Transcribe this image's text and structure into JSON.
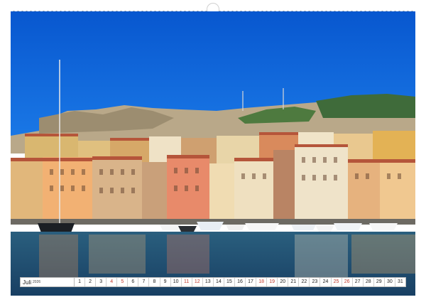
{
  "calendar": {
    "month": "Juli",
    "year": "2026",
    "days": [
      "1",
      "2",
      "3",
      "4",
      "5",
      "6",
      "7",
      "8",
      "9",
      "10",
      "11",
      "12",
      "13",
      "14",
      "15",
      "16",
      "17",
      "18",
      "19",
      "20",
      "21",
      "22",
      "23",
      "24",
      "25",
      "26",
      "27",
      "28",
      "29",
      "30",
      "31"
    ],
    "weekend_days": [
      "4",
      "5",
      "11",
      "12",
      "18",
      "19",
      "25",
      "26"
    ]
  },
  "colors": {
    "sky": "#0a63d8",
    "sea": "#1f5a86",
    "weekend": "#c0392b"
  }
}
